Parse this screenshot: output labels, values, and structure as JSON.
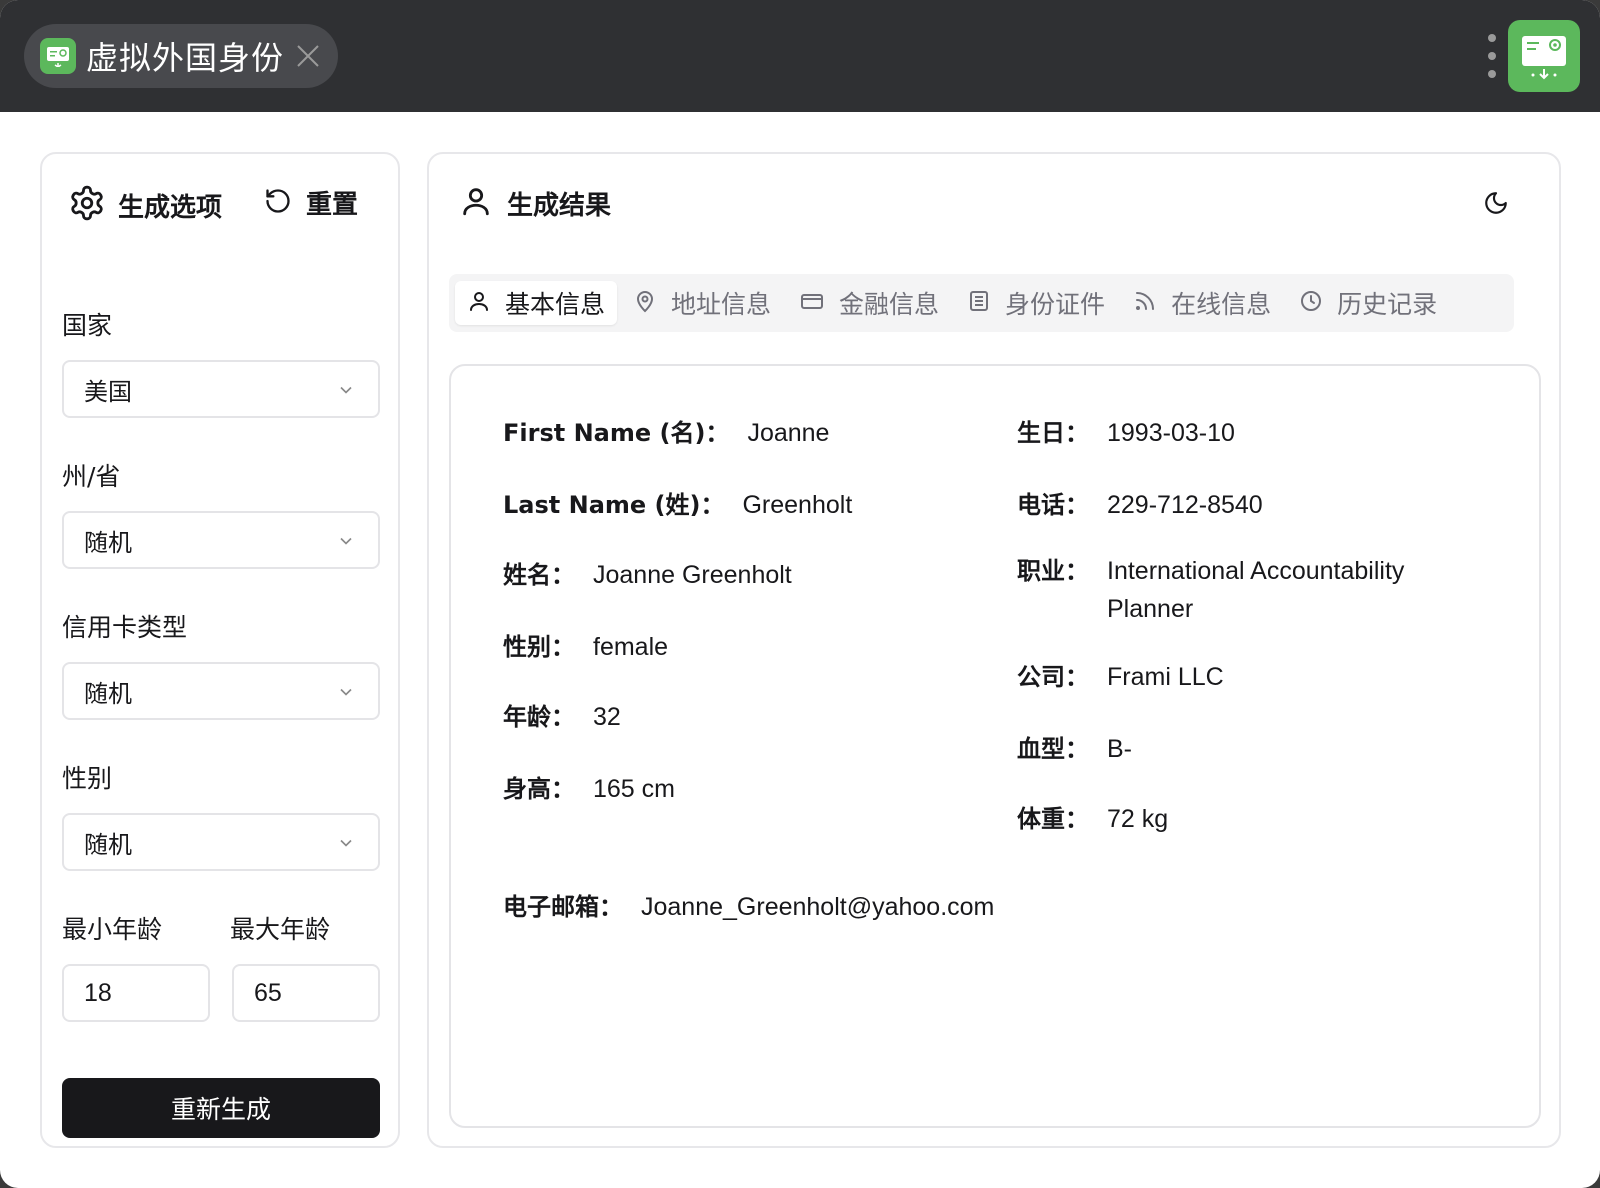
{
  "titlebar": {
    "tab_title": "虚拟外国身份"
  },
  "options": {
    "header": "生成选项",
    "reset_label": "重置",
    "country": {
      "label": "国家",
      "value": "美国"
    },
    "state": {
      "label": "州/省",
      "value": "随机"
    },
    "card_type": {
      "label": "信用卡类型",
      "value": "随机"
    },
    "gender": {
      "label": "性别",
      "value": "随机"
    },
    "min_age": {
      "label": "最小年龄",
      "value": "18"
    },
    "max_age": {
      "label": "最大年龄",
      "value": "65"
    },
    "regen_label": "重新生成"
  },
  "result": {
    "header": "生成结果",
    "tabs": [
      {
        "label": "基本信息",
        "icon": "user-icon",
        "active": true
      },
      {
        "label": "地址信息",
        "icon": "map-pin-icon",
        "active": false
      },
      {
        "label": "金融信息",
        "icon": "credit-card-icon",
        "active": false
      },
      {
        "label": "身份证件",
        "icon": "document-icon",
        "active": false
      },
      {
        "label": "在线信息",
        "icon": "rss-icon",
        "active": false
      },
      {
        "label": "历史记录",
        "icon": "clock-icon",
        "active": false
      }
    ],
    "basic": {
      "first_name": {
        "label": "First Name (名)：",
        "value": "Joanne"
      },
      "last_name": {
        "label": "Last Name (姓)：",
        "value": "Greenholt"
      },
      "full_name": {
        "label": "姓名：",
        "value": "Joanne Greenholt"
      },
      "gender": {
        "label": "性别：",
        "value": "female"
      },
      "age": {
        "label": "年龄：",
        "value": "32"
      },
      "height": {
        "label": "身高：",
        "value": "165 cm"
      },
      "birthday": {
        "label": "生日：",
        "value": "1993-03-10"
      },
      "phone": {
        "label": "电话：",
        "value": "229-712-8540"
      },
      "job": {
        "label": "职业：",
        "value": "International Accountability Planner"
      },
      "company": {
        "label": "公司：",
        "value": "Frami LLC"
      },
      "blood": {
        "label": "血型：",
        "value": "B-"
      },
      "weight": {
        "label": "体重：",
        "value": "72 kg"
      },
      "email": {
        "label": "电子邮箱：",
        "value": "Joanne_Greenholt@yahoo.com"
      }
    }
  },
  "colors": {
    "titlebar": "#2f3033",
    "brand_green": "#5cb85c",
    "button_dark": "#18181b",
    "border": "#e4e4e7"
  }
}
